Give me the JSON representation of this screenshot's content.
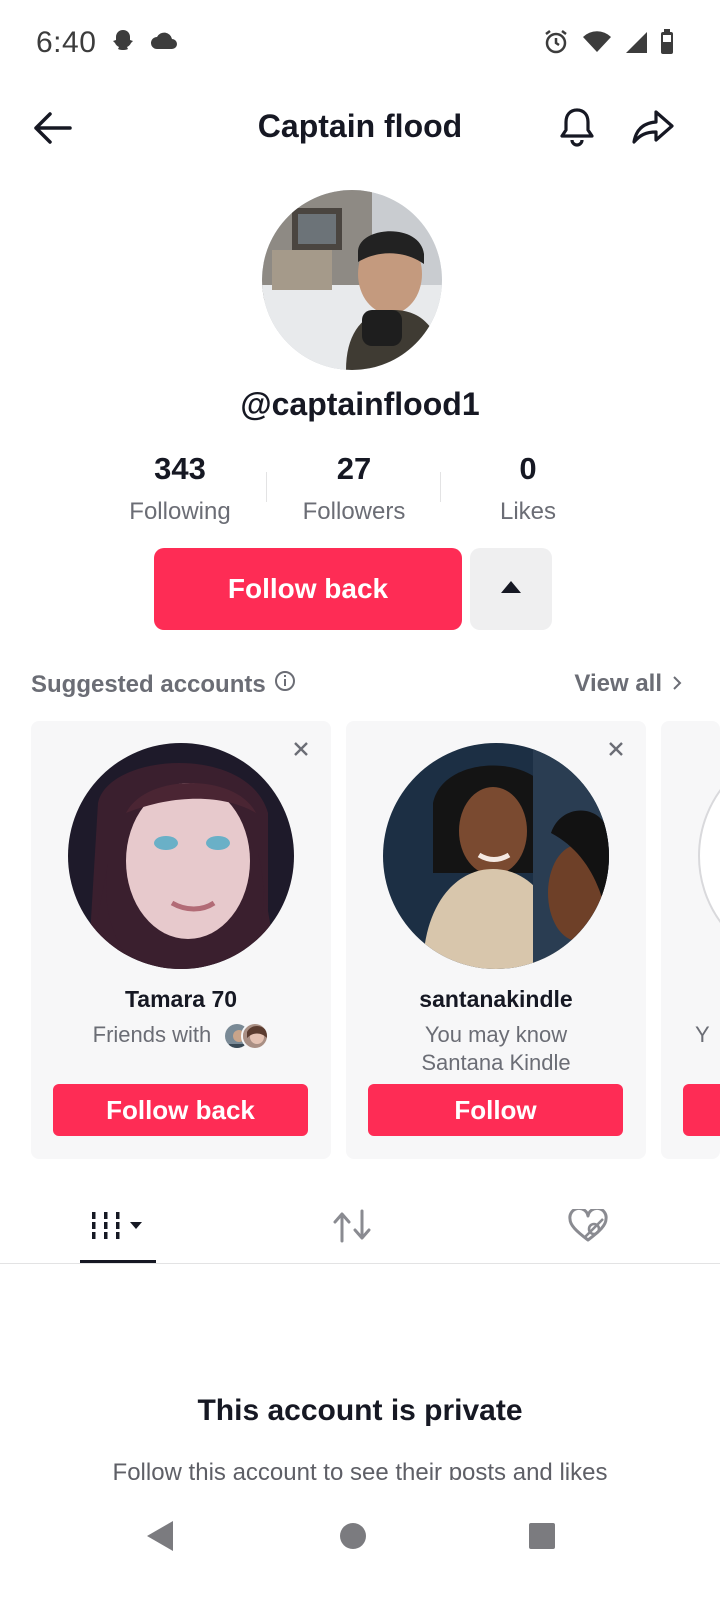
{
  "status_bar": {
    "time": "6:40",
    "left_icons": [
      "snapchat-icon",
      "cloud-icon"
    ],
    "right_icons": [
      "alarm-icon",
      "wifi-icon",
      "signal-icon",
      "battery-icon"
    ]
  },
  "header": {
    "title": "Captain flood",
    "back_icon": "arrow-left-icon",
    "bell_icon": "bell-icon",
    "share_icon": "share-icon"
  },
  "profile": {
    "username": "@captainflood1",
    "stats": [
      {
        "value": "343",
        "label": "Following"
      },
      {
        "value": "27",
        "label": "Followers"
      },
      {
        "value": "0",
        "label": "Likes"
      }
    ],
    "follow_back_label": "Follow back"
  },
  "suggested": {
    "title": "Suggested accounts",
    "view_all": "View all",
    "cards": [
      {
        "name": "Tamara 70",
        "sub": "Friends with",
        "button": "Follow back"
      },
      {
        "name": "santanakindle",
        "sub": "You may know Santana Kindle",
        "button": "Follow"
      },
      {
        "name": "",
        "sub": "Y",
        "button": ""
      }
    ]
  },
  "tabs": [
    {
      "icon": "grid-videos-icon",
      "active": true
    },
    {
      "icon": "repost-icon",
      "active": false
    },
    {
      "icon": "liked-hidden-icon",
      "active": false
    }
  ],
  "private": {
    "title": "This account is private",
    "subtitle": "Follow this account to see their posts and likes"
  },
  "colors": {
    "accent": "#fe2c55",
    "text_primary": "#161823",
    "text_secondary": "#6b6d75",
    "card_bg": "#f7f7f8"
  }
}
